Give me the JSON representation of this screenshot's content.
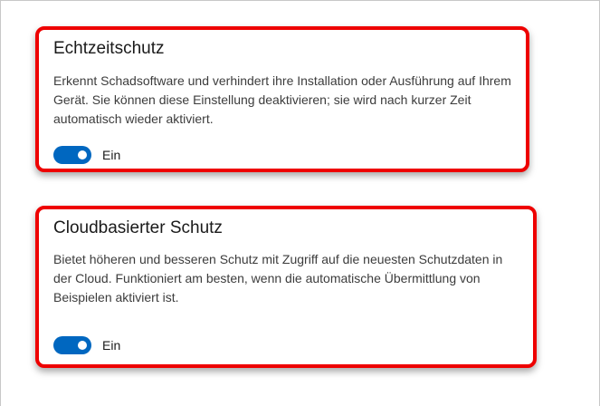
{
  "realtime_protection": {
    "title": "Echtzeitschutz",
    "description": "Erkennt Schadsoftware und verhindert ihre Installation oder Ausführung auf Ihrem Gerät. Sie können diese Einstellung deaktivieren; sie wird nach kurzer Zeit automatisch wieder aktiviert.",
    "toggle_on": true,
    "toggle_label": "Ein"
  },
  "cloud_protection": {
    "title": "Cloudbasierter Schutz",
    "description": "Bietet höheren und besseren Schutz mit Zugriff auf die neuesten Schutzdaten in der Cloud. Funktioniert am besten, wenn die automatische Übermittlung von Beispielen aktiviert ist.",
    "toggle_on": true,
    "toggle_label": "Ein"
  },
  "colors": {
    "toggle_accent": "#0067c0",
    "highlight_border": "#ee0000"
  }
}
